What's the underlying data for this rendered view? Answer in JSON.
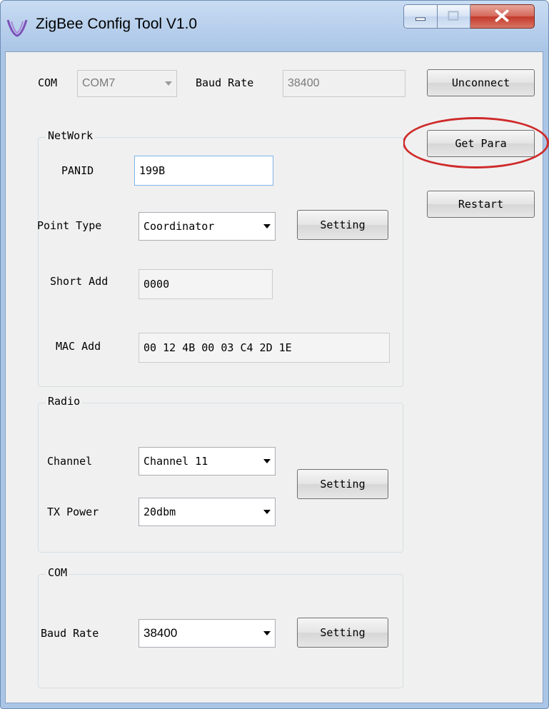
{
  "window": {
    "title": "ZigBee Config Tool V1.0",
    "icons": {
      "app": "zigbee-app-icon",
      "minimize": "minimize-icon",
      "maximize": "maximize-icon",
      "close": "close-icon"
    }
  },
  "connection": {
    "com_label": "COM",
    "com_port_value": "COM7",
    "baud_rate_label": "Baud Rate",
    "baud_rate_value": "38400"
  },
  "actions": {
    "unconnect_label": "Unconnect",
    "get_para_label": "Get Para",
    "restart_label": "Restart"
  },
  "network": {
    "group_title": "NetWork",
    "panid_label": "PANID",
    "panid_value": "199B",
    "point_type_label": "Point Type",
    "point_type_value": "Coordinator",
    "setting_label": "Setting",
    "short_add_label": "Short Add",
    "short_add_value": "0000",
    "mac_add_label": "MAC Add",
    "mac_add_value": "00 12 4B 00 03 C4 2D 1E"
  },
  "radio": {
    "group_title": "Radio",
    "channel_label": "Channel",
    "channel_value": "Channel 11",
    "tx_power_label": "TX Power",
    "tx_power_value": "20dbm",
    "setting_label": "Setting"
  },
  "com_group": {
    "group_title": "COM",
    "baud_rate_label": "Baud Rate",
    "baud_rate_value": "38400",
    "setting_label": "Setting"
  },
  "colors": {
    "highlight_ring": "#cf2a2a",
    "close_button": "#c3392b"
  }
}
